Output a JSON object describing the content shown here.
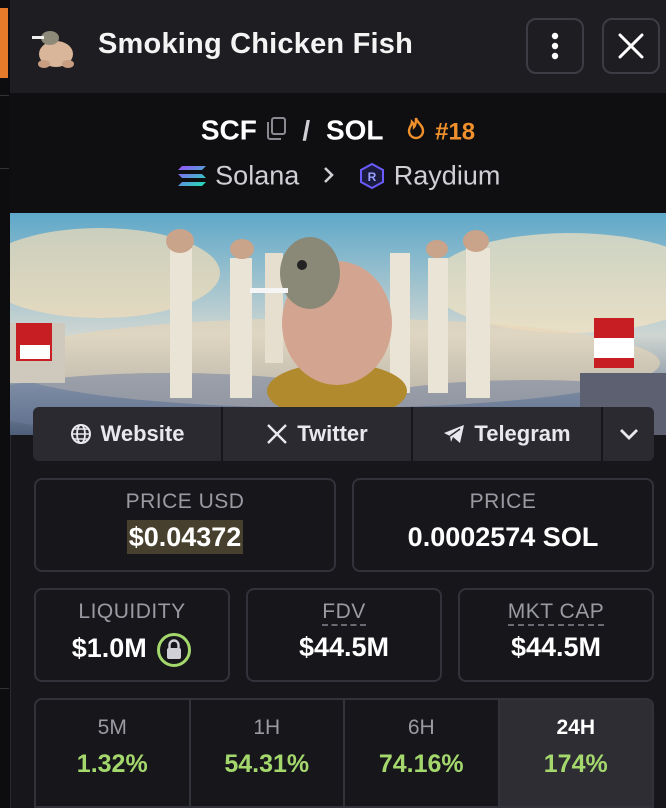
{
  "header": {
    "title": "Smoking Chicken Fish"
  },
  "pair": {
    "base": "SCF",
    "separator": "/",
    "quote": "SOL",
    "rank": "#18",
    "chain": "Solana",
    "dex": "Raydium"
  },
  "links": {
    "website": "Website",
    "twitter": "Twitter",
    "telegram": "Telegram"
  },
  "prices": {
    "usd_label": "PRICE USD",
    "usd_value": "$0.04372",
    "native_label": "PRICE",
    "native_value": "0.0002574 SOL"
  },
  "stats": {
    "liquidity_label": "LIQUIDITY",
    "liquidity_value": "$1.0M",
    "fdv_label": "FDV",
    "fdv_value": "$44.5M",
    "mktcap_label": "MKT CAP",
    "mktcap_value": "$44.5M"
  },
  "timeframes": [
    {
      "label": "5M",
      "value": "1.32%"
    },
    {
      "label": "1H",
      "value": "54.31%"
    },
    {
      "label": "6H",
      "value": "74.16%"
    },
    {
      "label": "24H",
      "value": "174%"
    }
  ],
  "colors": {
    "accent_orange": "#f0902c",
    "positive_green": "#a4d86d",
    "background": "#17171b"
  },
  "icons": [
    "chicken-fish-avatar",
    "kebab-menu-icon",
    "close-icon",
    "copy-icon",
    "flame-icon",
    "solana-icon",
    "chevron-right-icon",
    "raydium-icon",
    "globe-icon",
    "x-logo-icon",
    "telegram-icon",
    "chevron-down-icon",
    "lock-icon"
  ]
}
